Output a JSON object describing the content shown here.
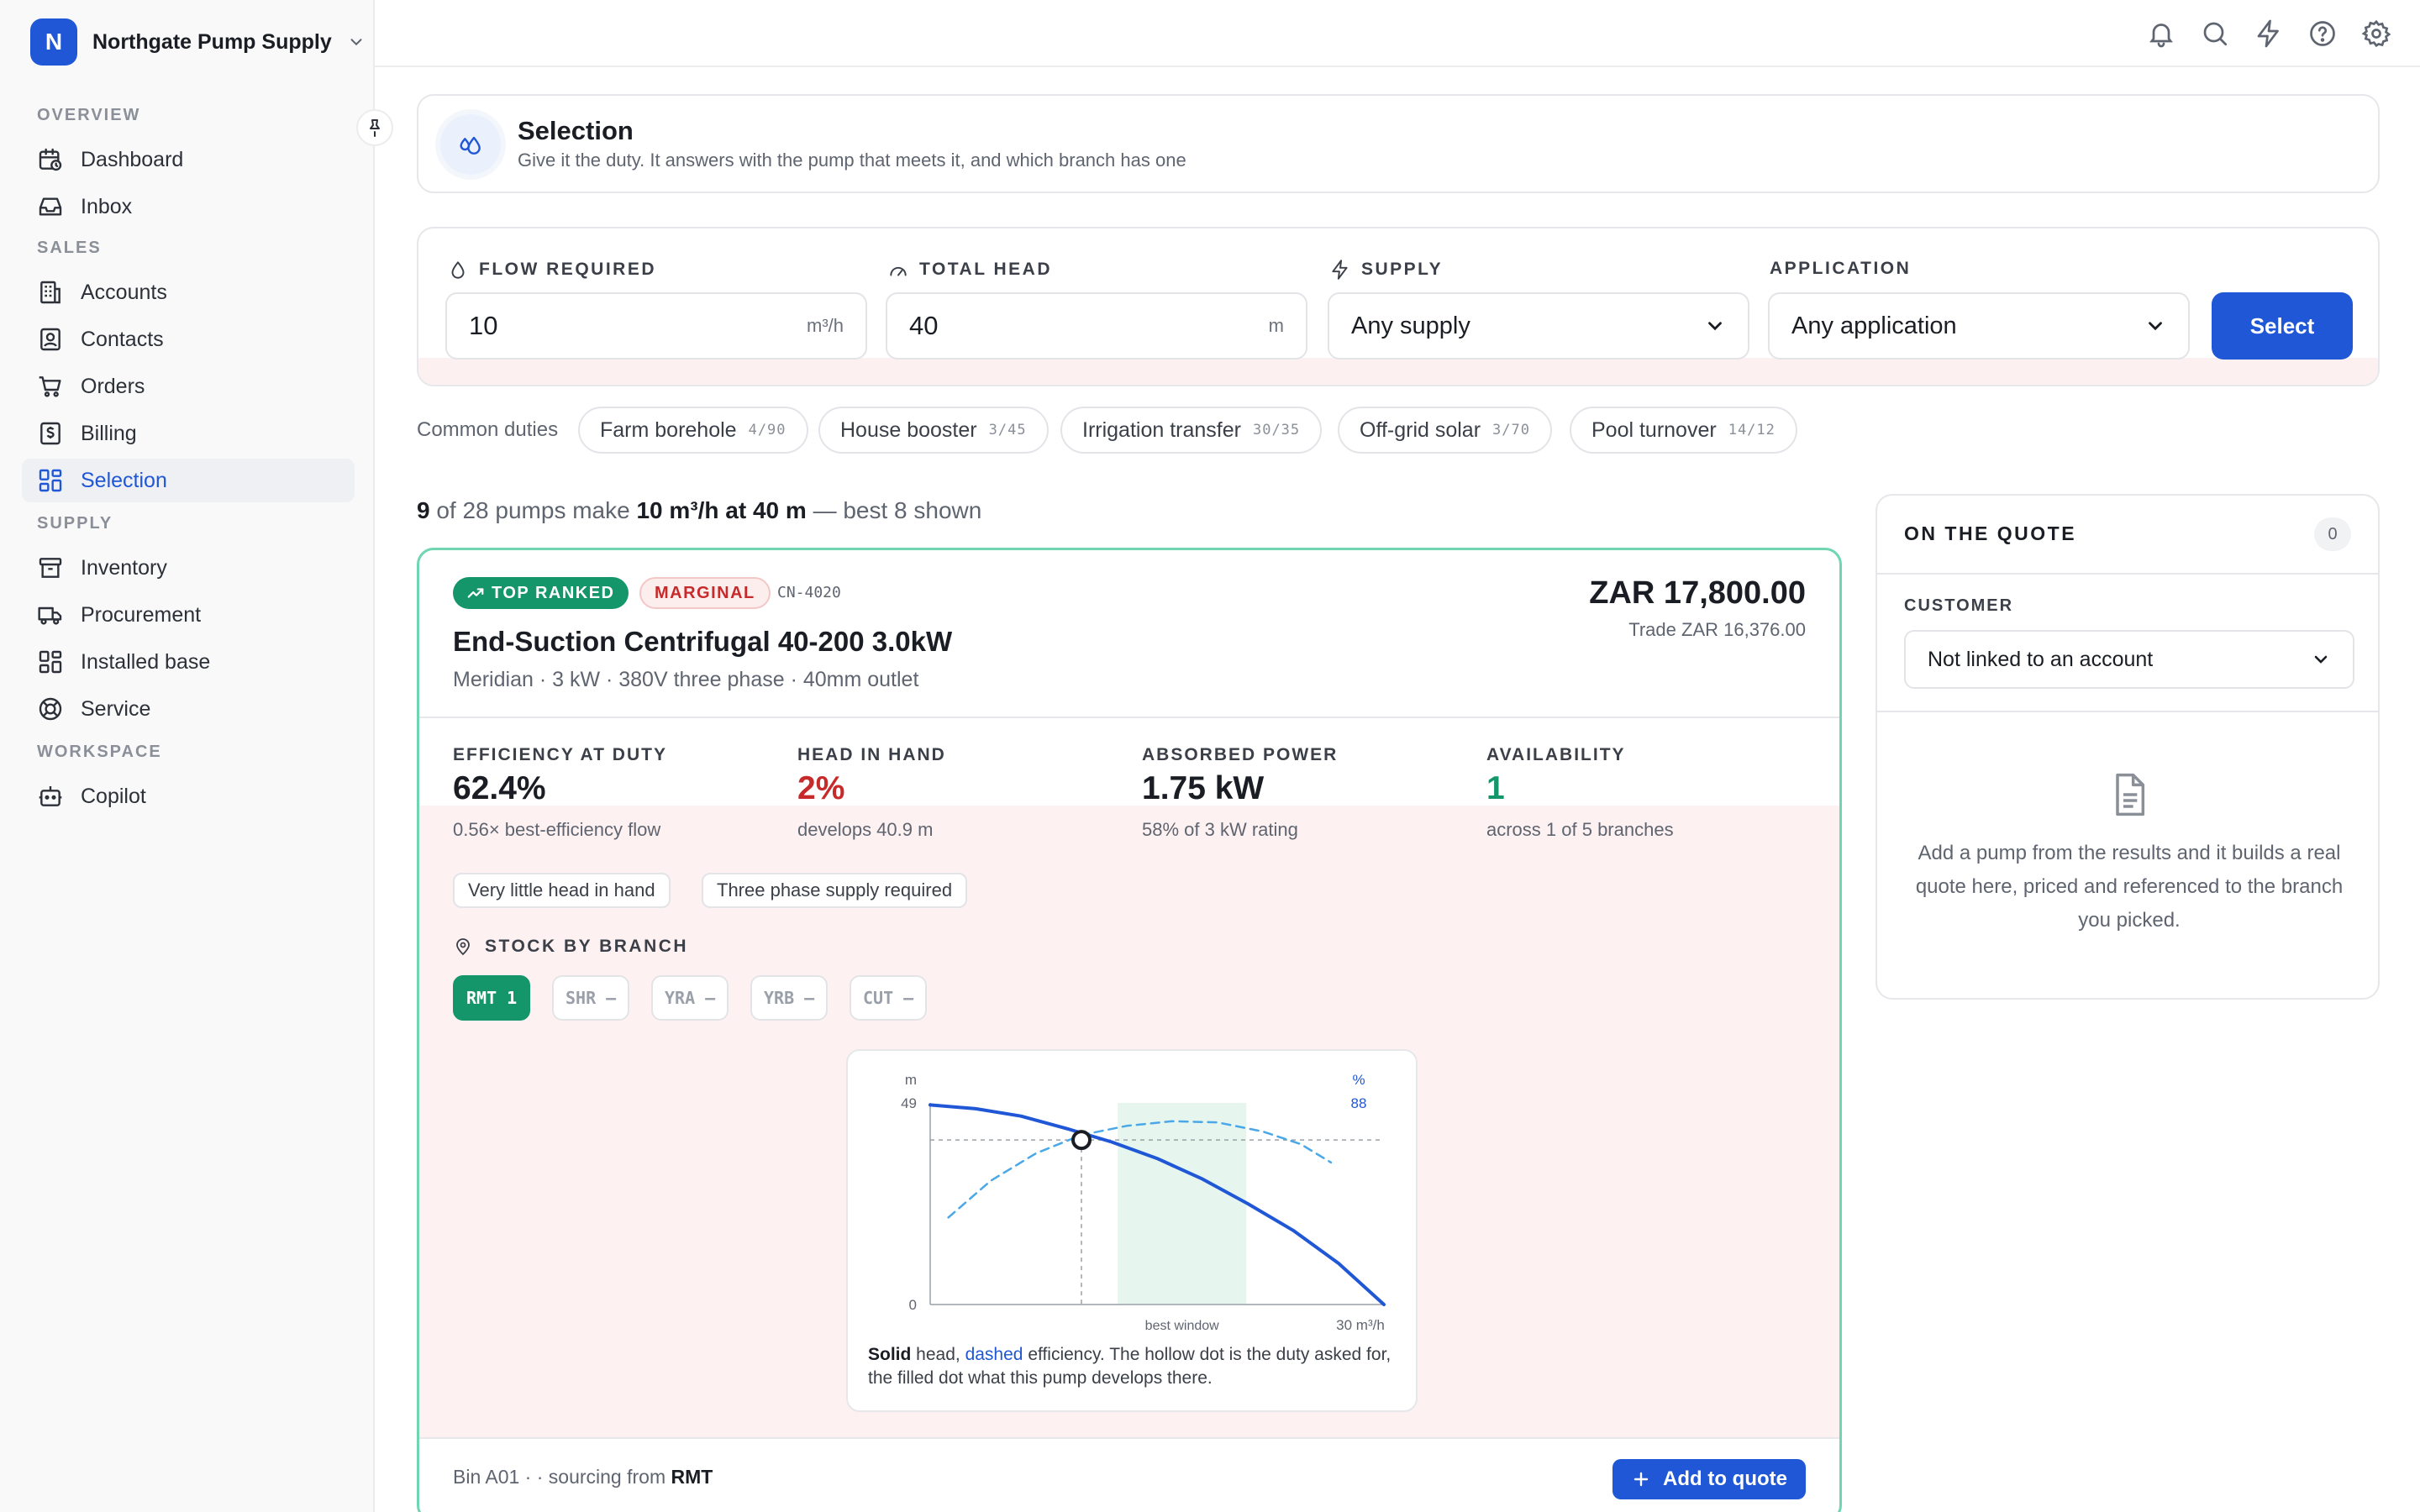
{
  "org": {
    "initial": "N",
    "name": "Northgate Pump Supply"
  },
  "sidebar": {
    "sections": [
      {
        "label": "OVERVIEW",
        "items": [
          {
            "label": "Dashboard",
            "icon": "calendar-clock-icon"
          },
          {
            "label": "Inbox",
            "icon": "inbox-icon"
          }
        ]
      },
      {
        "label": "SALES",
        "items": [
          {
            "label": "Accounts",
            "icon": "building-icon"
          },
          {
            "label": "Contacts",
            "icon": "contact-icon"
          },
          {
            "label": "Orders",
            "icon": "cart-icon"
          },
          {
            "label": "Billing",
            "icon": "receipt-icon"
          },
          {
            "label": "Selection",
            "icon": "grid-icon",
            "active": true
          }
        ]
      },
      {
        "label": "SUPPLY",
        "items": [
          {
            "label": "Inventory",
            "icon": "archive-icon"
          },
          {
            "label": "Procurement",
            "icon": "truck-icon"
          },
          {
            "label": "Installed base",
            "icon": "dashboard-icon"
          },
          {
            "label": "Service",
            "icon": "lifebuoy-icon"
          }
        ]
      },
      {
        "label": "WORKSPACE",
        "items": [
          {
            "label": "Copilot",
            "icon": "bot-icon"
          }
        ]
      }
    ]
  },
  "topbar": {
    "icons": [
      "bell-icon",
      "search-icon",
      "bolt-icon",
      "help-icon",
      "gear-icon"
    ]
  },
  "page": {
    "title": "Selection",
    "subtitle": "Give it the duty. It answers with the pump that meets it, and which branch has one"
  },
  "form": {
    "flow": {
      "label": "FLOW REQUIRED",
      "value": "10",
      "unit": "m³/h"
    },
    "head": {
      "label": "TOTAL HEAD",
      "value": "40",
      "unit": "m"
    },
    "supply": {
      "label": "SUPPLY",
      "value": "Any supply"
    },
    "application": {
      "label": "APPLICATION",
      "value": "Any application"
    },
    "submit": "Select"
  },
  "common_duties": {
    "label": "Common duties",
    "items": [
      {
        "name": "Farm borehole",
        "code": "4/90"
      },
      {
        "name": "House booster",
        "code": "3/45"
      },
      {
        "name": "Irrigation transfer",
        "code": "30/35"
      },
      {
        "name": "Off-grid solar",
        "code": "3/70"
      },
      {
        "name": "Pool turnover",
        "code": "14/12"
      }
    ]
  },
  "summary": {
    "matched": "9",
    "text1": " of 28 pumps make ",
    "duty": "10 m³/h at 40 m",
    "text2": " — best 8 shown"
  },
  "result": {
    "badge_top": "TOP RANKED",
    "badge_status": "MARGINAL",
    "sku": "CN-4020",
    "name": "End-Suction Centrifugal 40-200 3.0kW",
    "meta": "Meridian · 3 kW · 380V three phase · 40mm outlet",
    "price": "ZAR 17,800.00",
    "trade": "Trade ZAR 16,376.00",
    "metrics": [
      {
        "label": "EFFICIENCY AT DUTY",
        "value": "62.4%",
        "note": "0.56× best-efficiency flow",
        "color": "#1a1d23"
      },
      {
        "label": "HEAD IN HAND",
        "value": "2%",
        "note": "develops 40.9 m",
        "color": "#c62a2a"
      },
      {
        "label": "ABSORBED POWER",
        "value": "1.75 kW",
        "note": "58% of 3 kW rating",
        "color": "#1a1d23"
      },
      {
        "label": "AVAILABILITY",
        "value": "1",
        "note": "across 1 of 5 branches",
        "color": "#14966a"
      }
    ],
    "flags": [
      "Very little head in hand",
      "Three phase supply required"
    ],
    "stock_label": "STOCK BY BRANCH",
    "branches": [
      {
        "code": "RMT",
        "count": "1",
        "in_stock": true
      },
      {
        "code": "SHR",
        "count": "—",
        "in_stock": false
      },
      {
        "code": "YRA",
        "count": "—",
        "in_stock": false
      },
      {
        "code": "YRB",
        "count": "—",
        "in_stock": false
      },
      {
        "code": "CUT",
        "count": "—",
        "in_stock": false
      }
    ],
    "caption": {
      "solid": "Solid",
      "t1": " head, ",
      "dashed": "dashed",
      "t2": " efficiency. The hollow dot is the duty asked for, the filled dot what this pump develops there."
    },
    "bin": "Bin A01 · · sourcing from ",
    "bin_branch": "RMT",
    "add_label": "Add to quote"
  },
  "chart_data": {
    "type": "line",
    "x_unit": "m³/h",
    "xlim": [
      0,
      30
    ],
    "ylim_left": [
      0,
      49
    ],
    "ylim_right": [
      0,
      88
    ],
    "y_unit_left": "m",
    "y_unit_right": "%",
    "y_ticks_left": [
      "49",
      "0"
    ],
    "y_tick_right": "88",
    "x_tick_label": "30 m³/h",
    "band_label": "best window",
    "best_window": [
      12.4,
      20.9
    ],
    "series": [
      {
        "style": "solid",
        "x": [
          0,
          3,
          6,
          9,
          12,
          15,
          18,
          21,
          24,
          27,
          30
        ],
        "y": [
          48.5,
          47.6,
          45.8,
          42.8,
          39.5,
          35.5,
          30.5,
          24.5,
          18,
          10,
          0
        ]
      },
      {
        "style": "dashed",
        "x": [
          1.2,
          4,
          7,
          10,
          13,
          16,
          19,
          22,
          24.5,
          26.5
        ],
        "y": [
          38,
          54,
          66,
          74,
          78,
          80,
          79.5,
          75.5,
          70,
          62
        ]
      }
    ],
    "duty_point": {
      "x": 10,
      "y": 40
    },
    "grid": false,
    "legend": "none"
  }
}
